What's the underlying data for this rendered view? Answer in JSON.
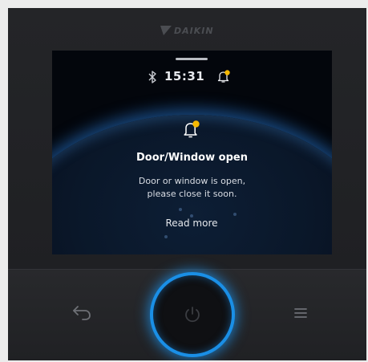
{
  "brand": {
    "name": "DAIKIN",
    "logo_icon": "daikin-triangle-logo"
  },
  "status_bar": {
    "time": "15:31",
    "bluetooth_icon": "bluetooth-icon",
    "notification_icon": "bell-with-dot-icon"
  },
  "alert": {
    "icon": "bell-with-dot-icon",
    "title": "Door/Window open",
    "body_line1": "Door or window is open,",
    "body_line2": "please close it soon.",
    "action": "Read more"
  },
  "controls": {
    "back_icon": "back-arrow-icon",
    "power_icon": "power-icon",
    "menu_icon": "hamburger-menu-icon"
  },
  "colors": {
    "accent_blue": "#1a8fe6",
    "notification_dot": "#f5b800",
    "device_body": "#1d1e20",
    "screen_bg": "#03060c"
  }
}
